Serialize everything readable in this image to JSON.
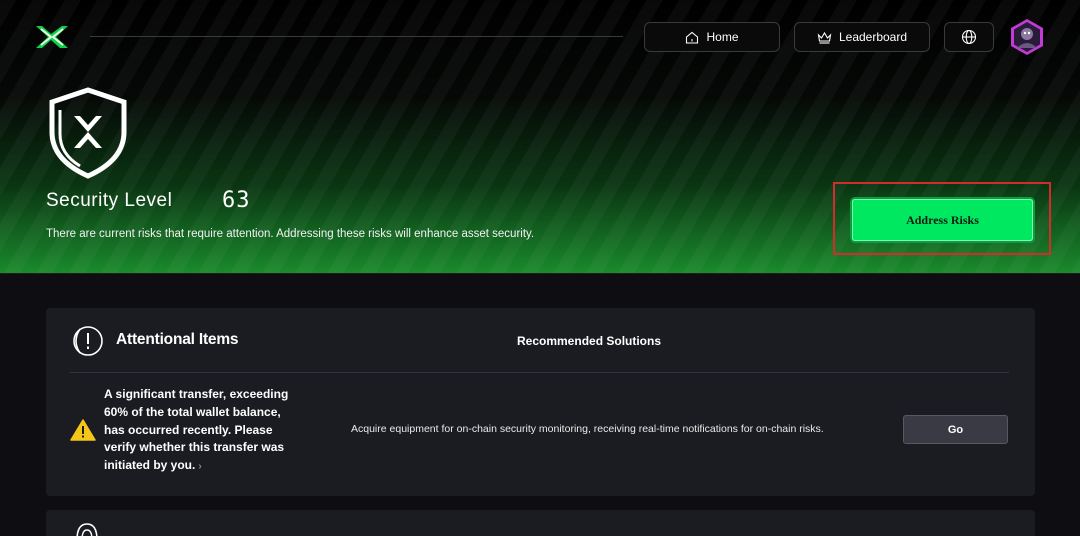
{
  "header": {
    "logo": "x-logo-icon",
    "nav": {
      "home_label": "Home",
      "home_icon": "home-icon",
      "leaderboard_label": "Leaderboard",
      "leaderboard_icon": "crown-icon",
      "language_icon": "globe-icon"
    },
    "avatar": "user-avatar"
  },
  "security": {
    "shield_icon": "shield-x-icon",
    "label": "Security Level",
    "score": "63",
    "description": "There are current risks that require attention. Addressing these risks will enhance asset security.",
    "address_risks_label": "Address Risks"
  },
  "attention": {
    "icon": "exclamation-circle-icon",
    "title": "Attentional Items",
    "solutions_header": "Recommended Solutions",
    "items": [
      {
        "icon": "warning-triangle-icon",
        "text": "A significant transfer, exceeding 60% of the total wallet balance, has occurred recently. Please verify whether this transfer was initiated by you.",
        "more": "›",
        "solution": "Acquire equipment for on-chain security monitoring, receiving real-time notifications for on-chain risks.",
        "action_label": "Go"
      }
    ]
  },
  "colors": {
    "accent_green": "#00e860",
    "highlight_red": "#d42c2c",
    "warning_yellow": "#f5c518",
    "background": "#0d0d12",
    "card": "#1b1b22"
  }
}
